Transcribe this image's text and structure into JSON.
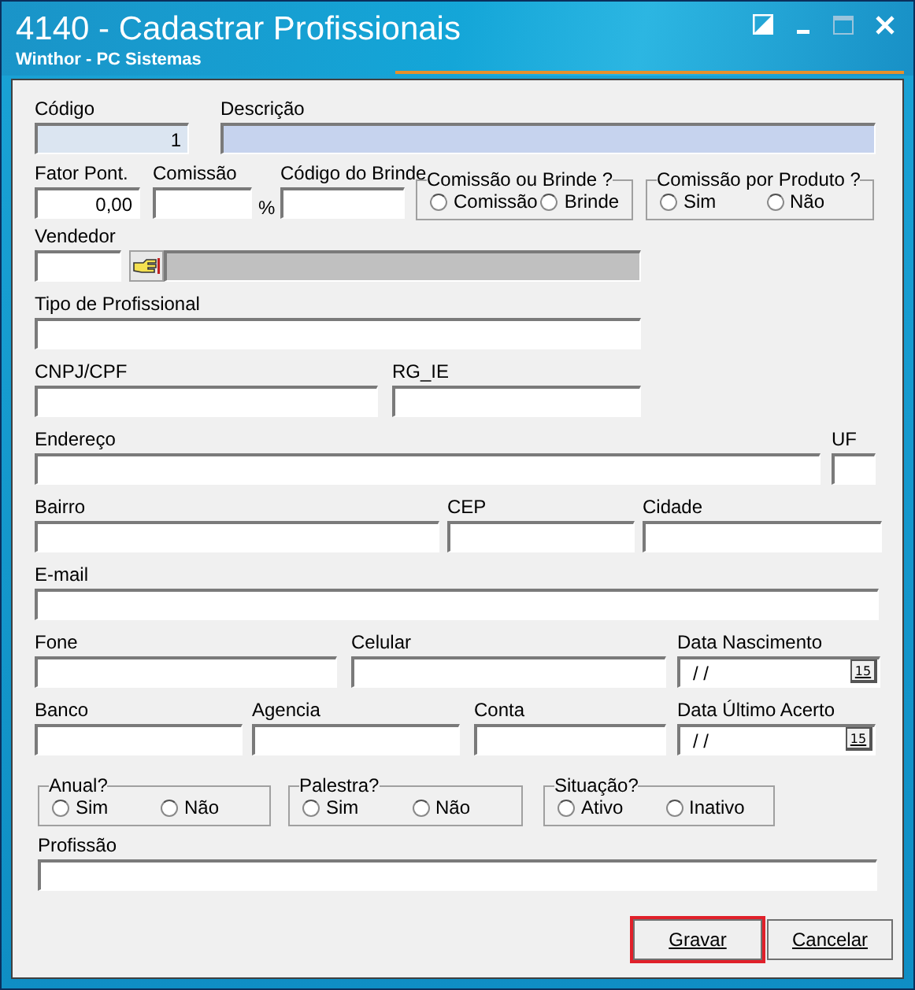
{
  "window": {
    "title": "4140 - Cadastrar Profissionais",
    "subtitle": "Winthor - PC Sistemas"
  },
  "form": {
    "lines": [
      {
        "fields": [
          {
            "kind": "field",
            "label": "Código",
            "value": "1",
            "readonly": true
          },
          {
            "kind": "field",
            "label": "Descrição",
            "focused": true
          }
        ]
      },
      {
        "fields": [
          {
            "kind": "field",
            "label": "Fator Pont.",
            "value": "0,00"
          },
          {
            "kind": "percent",
            "label": "Comissão",
            "suffix": "%"
          },
          {
            "kind": "field",
            "label": "Código do Brinde"
          },
          {
            "kind": "radio-group",
            "title": "Comissão ou Brinde ?",
            "options": [
              {
                "label": "Comissão",
                "selected": false
              },
              {
                "label": "Brinde",
                "selected": false
              }
            ]
          },
          {
            "kind": "radio-group",
            "title": "Comissão por Produto ?",
            "options": [
              {
                "label": "Sim",
                "selected": false
              },
              {
                "label": "Não",
                "selected": false
              }
            ]
          }
        ]
      },
      {
        "fields": [
          {
            "kind": "lookup",
            "label": "Vendedor",
            "disabled": true
          }
        ]
      },
      {
        "fields": [
          {
            "kind": "field",
            "label": "Tipo de Profissional"
          }
        ]
      },
      {
        "fields": [
          {
            "kind": "field",
            "label": "CNPJ/CPF"
          },
          {
            "kind": "field",
            "label": "RG_IE"
          }
        ]
      },
      {
        "fields": [
          {
            "kind": "field",
            "label": "Endereço"
          },
          {
            "kind": "field",
            "label": "UF"
          }
        ]
      },
      {
        "fields": [
          {
            "kind": "field",
            "label": "Bairro"
          },
          {
            "kind": "field",
            "label": "CEP"
          },
          {
            "kind": "field",
            "label": "Cidade"
          }
        ]
      },
      {
        "fields": [
          {
            "kind": "field",
            "label": "E-mail"
          }
        ]
      },
      {
        "fields": [
          {
            "kind": "field",
            "label": "Fone"
          },
          {
            "kind": "field",
            "label": "Celular"
          },
          {
            "kind": "date",
            "label": "Data Nascimento",
            "value": "/ /",
            "button": "15"
          }
        ]
      },
      {
        "fields": [
          {
            "kind": "field",
            "label": "Banco"
          },
          {
            "kind": "field",
            "label": "Agencia"
          },
          {
            "kind": "field",
            "label": "Conta"
          },
          {
            "kind": "date",
            "label": "Data Último Acerto",
            "value": "/ /",
            "button": "15"
          }
        ]
      },
      {
        "fields": [
          {
            "kind": "radio-group",
            "title": "Anual?",
            "options": [
              {
                "label": "Sim",
                "selected": false
              },
              {
                "label": "Não",
                "selected": false
              }
            ]
          },
          {
            "kind": "radio-group",
            "title": "Palestra?",
            "options": [
              {
                "label": "Sim",
                "selected": false
              },
              {
                "label": "Não",
                "selected": false
              }
            ]
          },
          {
            "kind": "radio-group",
            "title": "Situação?",
            "options": [
              {
                "label": "Ativo",
                "selected": false
              },
              {
                "label": "Inativo",
                "selected": false
              }
            ]
          }
        ]
      },
      {
        "fields": [
          {
            "kind": "field",
            "label": "Profissão"
          }
        ]
      }
    ]
  },
  "buttons": [
    {
      "label": "Gravar",
      "highlighted": true
    },
    {
      "label": "Cancelar",
      "highlighted": false
    }
  ]
}
